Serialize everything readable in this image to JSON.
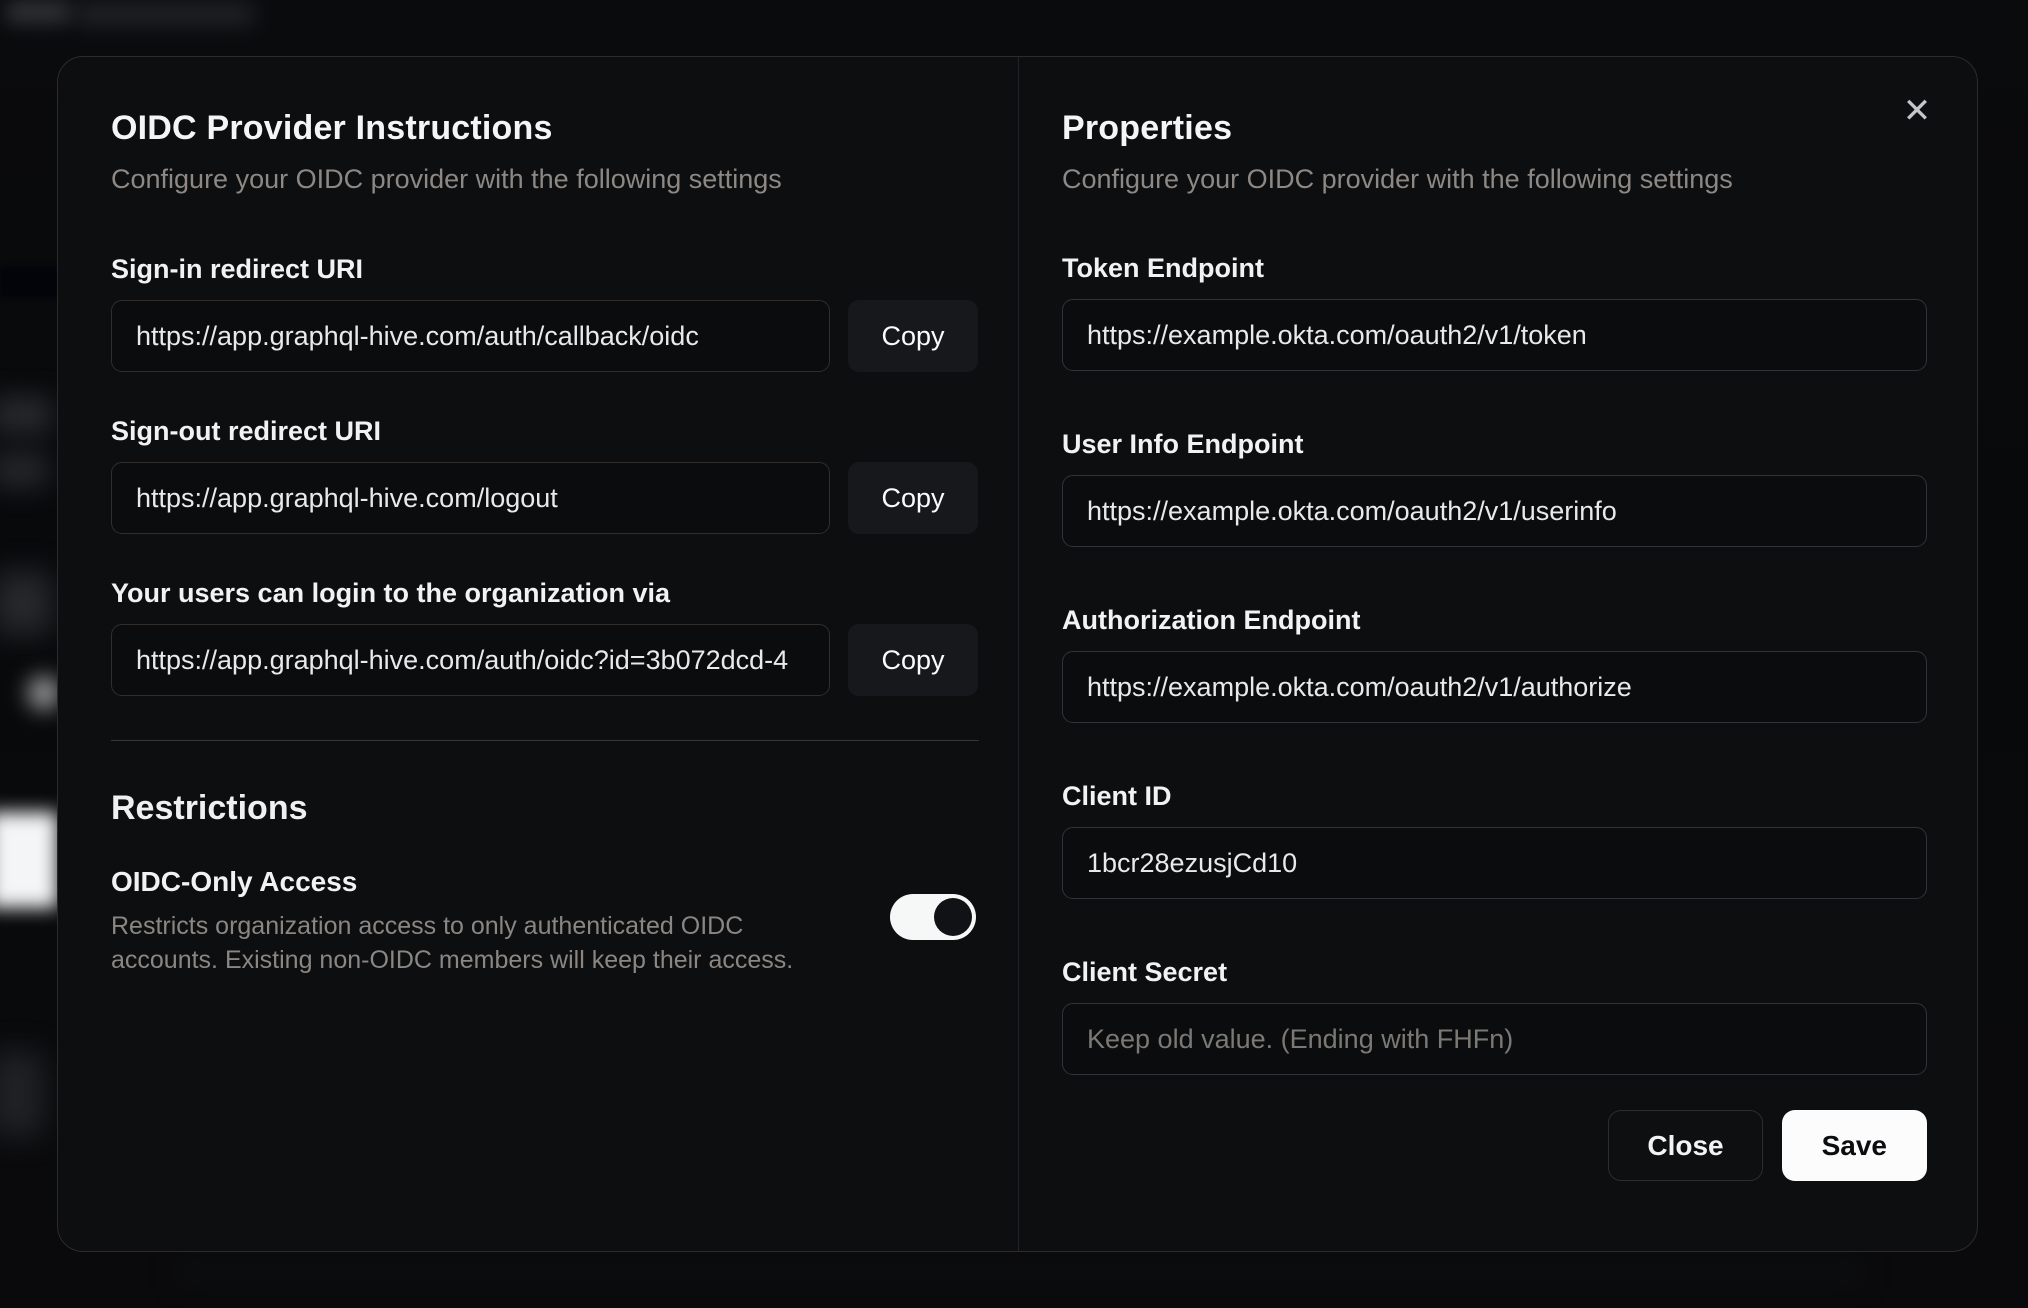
{
  "modal": {
    "close_icon": "✕",
    "left": {
      "title": "OIDC Provider Instructions",
      "subtitle": "Configure your OIDC provider with the following settings",
      "fields": [
        {
          "label": "Sign-in redirect URI",
          "value": "https://app.graphql-hive.com/auth/callback/oidc",
          "button": "Copy"
        },
        {
          "label": "Sign-out redirect URI",
          "value": "https://app.graphql-hive.com/logout",
          "button": "Copy"
        },
        {
          "label": "Your users can login to the organization via",
          "value": "https://app.graphql-hive.com/auth/oidc?id=3b072dcd-4",
          "button": "Copy"
        }
      ],
      "restrictions": {
        "title": "Restrictions",
        "toggle_label": "OIDC-Only Access",
        "toggle_description": "Restricts organization access to only authenticated OIDC accounts. Existing non-OIDC members will keep their access.",
        "toggle_state": "on"
      }
    },
    "right": {
      "title": "Properties",
      "subtitle": "Configure your OIDC provider with the following settings",
      "fields": [
        {
          "label": "Token Endpoint",
          "value": "https://example.okta.com/oauth2/v1/token"
        },
        {
          "label": "User Info Endpoint",
          "value": "https://example.okta.com/oauth2/v1/userinfo"
        },
        {
          "label": "Authorization Endpoint",
          "value": "https://example.okta.com/oauth2/v1/authorize"
        },
        {
          "label": "Client ID",
          "value": "1bcr28ezusjCd10"
        },
        {
          "label": "Client Secret",
          "value": "",
          "placeholder": "Keep old value. (Ending with FHFn)"
        }
      ],
      "buttons": {
        "close": "Close",
        "save": "Save"
      }
    }
  },
  "colors": {
    "modal_background": "#0d0e10",
    "modal_border": "#2e2b28",
    "primary_button_bg": "#fcfcfd",
    "primary_button_text": "#0c0d0e",
    "toggle_on_track": "#f6f7f7",
    "toggle_knob": "#101216",
    "muted_text": "#8d8883",
    "input_border": "#312e2b"
  }
}
